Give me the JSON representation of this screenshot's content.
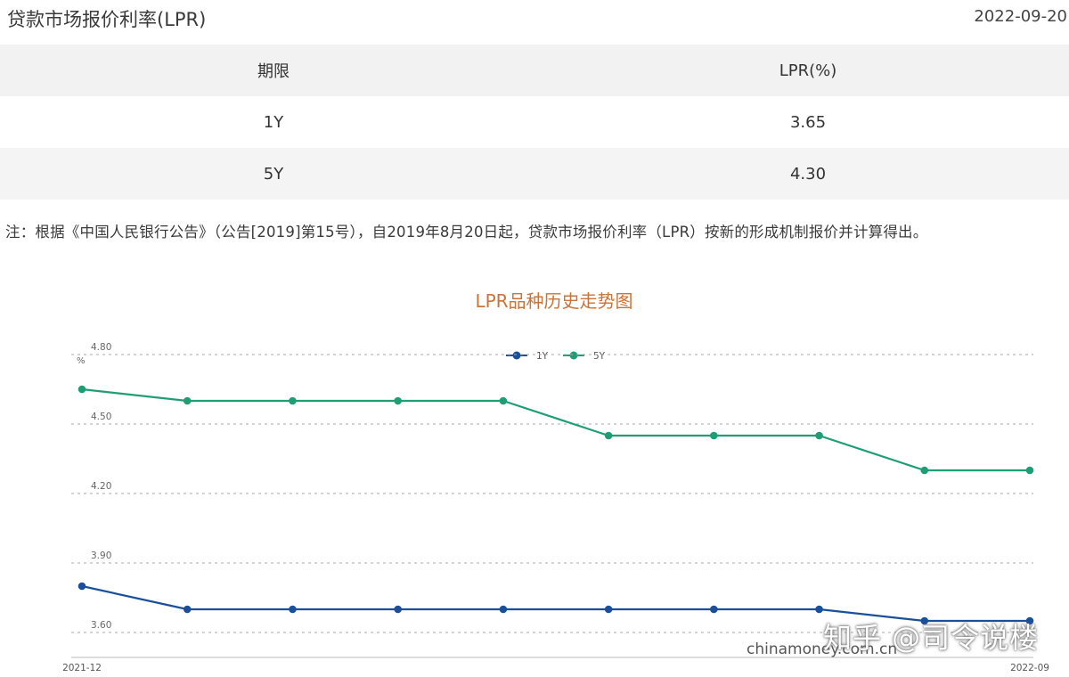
{
  "header": {
    "title": "贷款市场报价利率(LPR)",
    "date": "2022-09-20"
  },
  "table": {
    "headers": [
      "期限",
      "LPR(%)"
    ],
    "rows": [
      {
        "term": "1Y",
        "rate": "3.65"
      },
      {
        "term": "5Y",
        "rate": "4.30"
      }
    ]
  },
  "note": "注：根据《中国人民银行公告》（公告[2019]第15号），自2019年8月20日起，贷款市场报价利率（LPR）按新的形成机制报价并计算得出。",
  "watermark": "知乎 @司令说楼",
  "chart_data": {
    "type": "line",
    "title": "LPR品种历史走势图",
    "ylabel": "%",
    "ylim": [
      3.55,
      4.85
    ],
    "yticks": [
      "3.60",
      "3.90",
      "4.20",
      "4.50",
      "4.80"
    ],
    "x_labels": [
      "2021-12",
      "2022-09"
    ],
    "x": [
      "2021-12",
      "2022-01",
      "2022-02",
      "2022-03",
      "2022-04",
      "2022-05",
      "2022-06",
      "2022-07",
      "2022-08",
      "2022-09"
    ],
    "series": [
      {
        "name": "1Y",
        "color": "#1a4f9c",
        "values": [
          3.8,
          3.7,
          3.7,
          3.7,
          3.7,
          3.7,
          3.7,
          3.7,
          3.65,
          3.65
        ]
      },
      {
        "name": "5Y",
        "color": "#1f9e74",
        "values": [
          4.65,
          4.6,
          4.6,
          4.6,
          4.6,
          4.45,
          4.45,
          4.45,
          4.3,
          4.3
        ]
      }
    ],
    "source": "chinamoney.com.cn",
    "grid": true,
    "legend": "top-center"
  }
}
